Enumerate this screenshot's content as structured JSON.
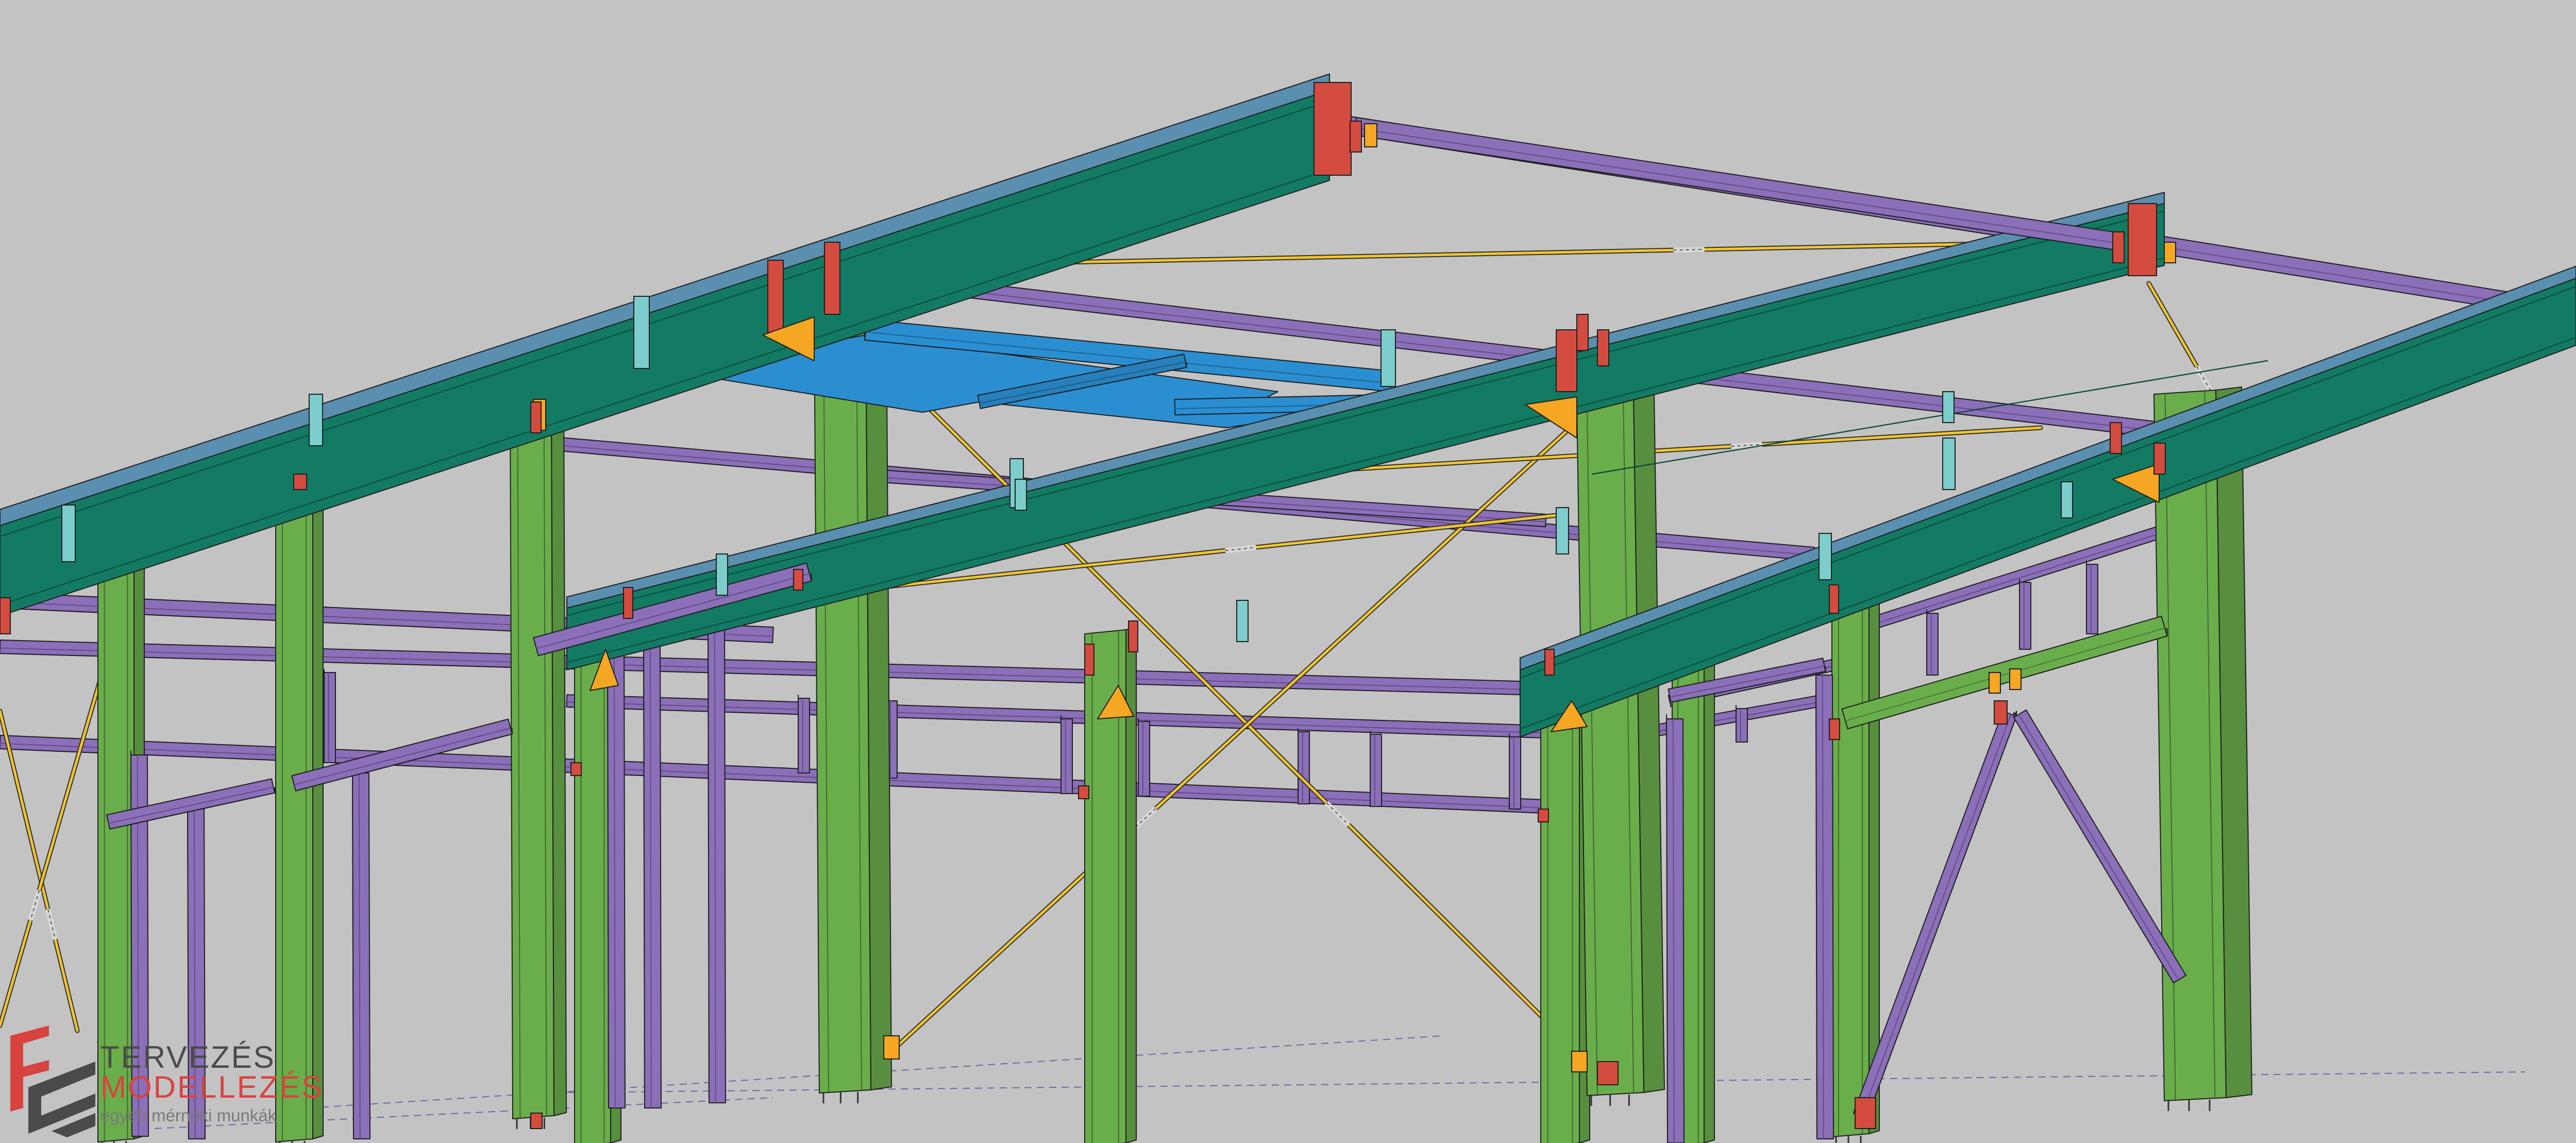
{
  "logo": {
    "line1": "TERVEZÉS",
    "line2": "MODELLEZÉS",
    "line3": "egyéb mérnöki munkák"
  },
  "colors": {
    "background": "#c3c3c3",
    "roof_beam": "#137b63",
    "roof_beam_top": "#5a8fb0",
    "purlin": "#8b6fb9",
    "column": "#6aae4c",
    "end_plate": "#d44b3f",
    "bracing_rod": "#f0c530",
    "stiffener": "#f5a623",
    "cleat": "#7ccdcc",
    "trimmer": "#2b8ed1",
    "logo_red": "#d8433f",
    "logo_grey": "#4a4a4a"
  }
}
